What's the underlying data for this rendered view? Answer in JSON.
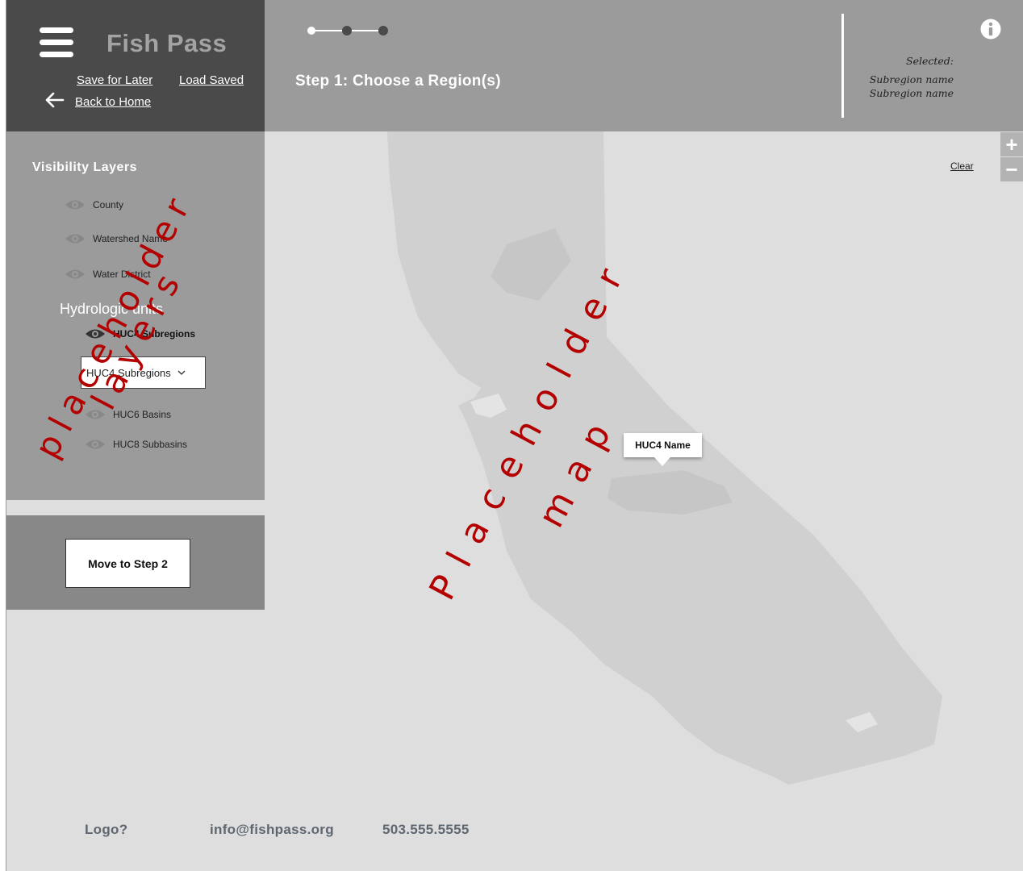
{
  "header": {
    "app_title": "Fish Pass",
    "save_link": "Save  for Later",
    "load_link": "Load Saved",
    "back_link": "Back to Home",
    "step_title": "Step 1: Choose a Region(s)",
    "selected_label": "Selected:",
    "selected_items": [
      "Subregion name",
      "Subregion name"
    ],
    "stepper": {
      "steps": 3,
      "current": 1
    }
  },
  "sidebar": {
    "title": "Visibility Layers",
    "layers": [
      {
        "label": "County",
        "icon": "eye-icon"
      },
      {
        "label": "Watershed Name",
        "icon": "eye-icon"
      },
      {
        "label": "Water District",
        "icon": "eye-icon"
      }
    ],
    "hydrologic_title": "Hydrologic units",
    "hydrologic_layers": [
      {
        "label": "HUC4 Subregions",
        "icon": "eye-icon",
        "active": true
      },
      {
        "label": "HUC6 Basins",
        "icon": "eye-icon",
        "active": false
      },
      {
        "label": "HUC8 Subbasins",
        "icon": "eye-icon",
        "active": false
      }
    ],
    "dropdown_value": "HUC4 Subregions",
    "placeholder_text": [
      "placeholder",
      "layers"
    ]
  },
  "actions": {
    "move_button": "Move to Step 2"
  },
  "map": {
    "clear_link": "Clear",
    "zoom_in": "+",
    "zoom_out": "−",
    "tooltip": "HUC4 Name",
    "placeholder_text": [
      "Placeholder",
      "map"
    ]
  },
  "footer": {
    "logo": "Logo?",
    "email": "info@fishpass.org",
    "phone": "503.555.5555"
  },
  "colors": {
    "header_bg": "#9b9b9b",
    "brand_bg": "#4a4a4a",
    "map_bg": "#dedede",
    "map_land": "#d0d0d0",
    "placeholder_red": "#b30000"
  }
}
